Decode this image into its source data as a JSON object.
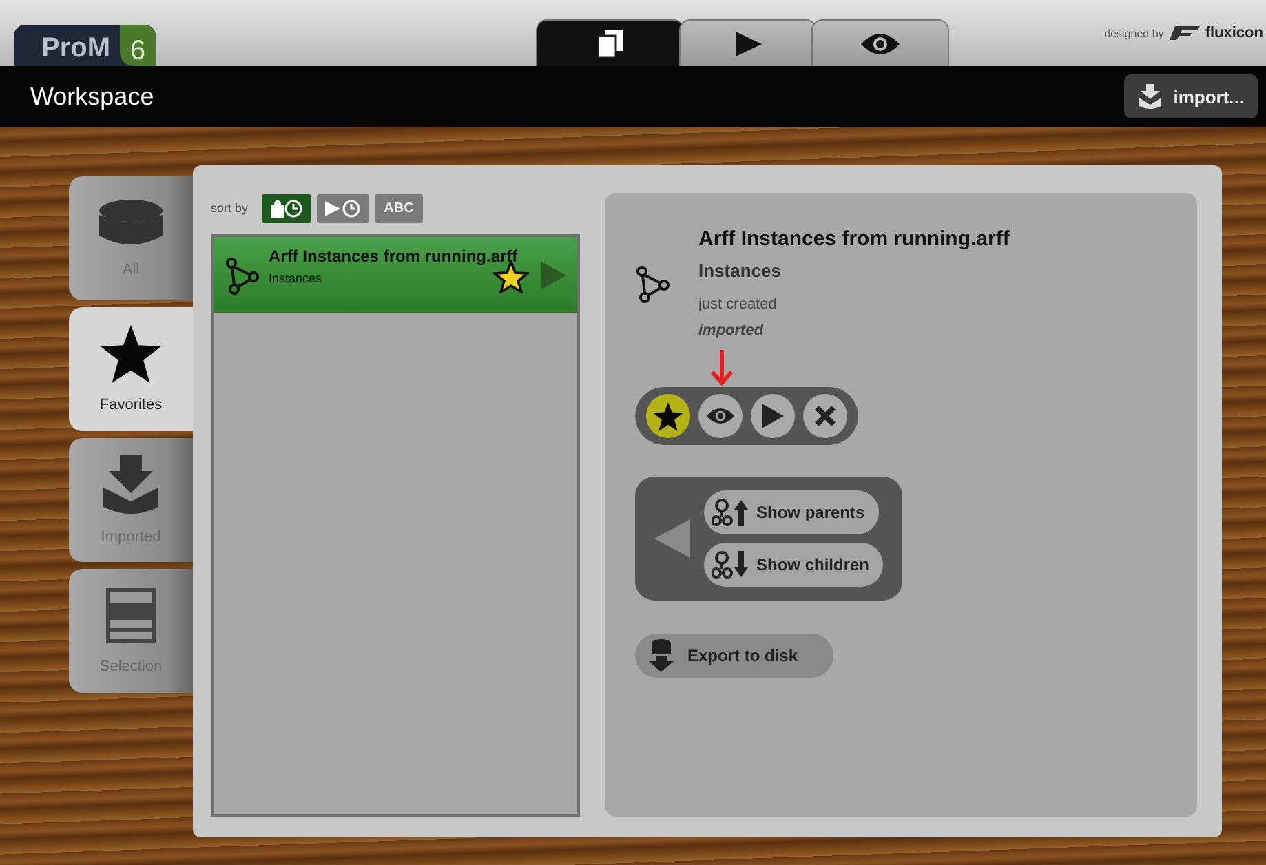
{
  "header": {
    "logo": "ProM",
    "logo_version": "6",
    "credit": "designed by",
    "credit_brand": "fluxicon"
  },
  "views": [
    {
      "kind": "workspace",
      "selected": true
    },
    {
      "kind": "actions",
      "selected": false
    },
    {
      "kind": "views",
      "selected": false
    }
  ],
  "toolbar": {
    "title": "Workspace",
    "import_button": "import..."
  },
  "sidebar": {
    "items": [
      {
        "kind": "all",
        "label": "All",
        "selected": false
      },
      {
        "kind": "favorites",
        "label": "Favorites",
        "selected": true
      },
      {
        "kind": "imported",
        "label": "Imported",
        "selected": false
      },
      {
        "kind": "selection",
        "label": "Selection",
        "selected": false
      }
    ]
  },
  "sort": {
    "label": "sort by",
    "options": [
      {
        "kind": "created",
        "selected": true
      },
      {
        "kind": "used",
        "selected": false
      },
      {
        "kind": "alpha",
        "label": "ABC",
        "selected": false
      }
    ]
  },
  "resources": [
    {
      "name": "Arff Instances from running.arff",
      "type": "Instances",
      "selected": true,
      "favorite": true
    }
  ],
  "detail": {
    "name": "Arff Instances from running.arff",
    "type": "Instances",
    "created": "just created",
    "origin": "imported",
    "actions": [
      {
        "kind": "favorite"
      },
      {
        "kind": "view"
      },
      {
        "kind": "play"
      },
      {
        "kind": "remove"
      }
    ],
    "show_parents": "Show parents",
    "show_children": "Show children",
    "export": "Export to disk"
  }
}
